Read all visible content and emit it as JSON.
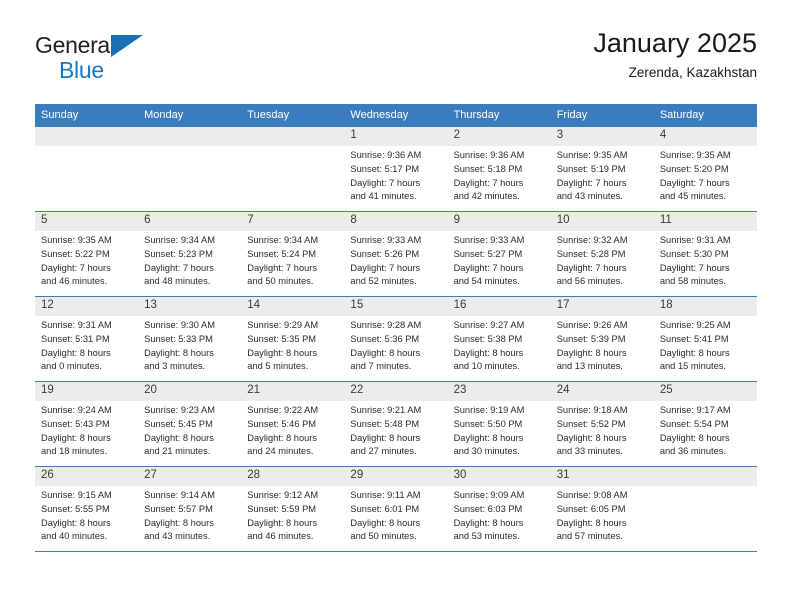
{
  "brand": {
    "name_part1": "General",
    "name_part2": "Blue",
    "flag_icon": "triangle-flag-icon"
  },
  "header": {
    "title": "January 2025",
    "subtitle": "Zerenda, Kazakhstan"
  },
  "colors": {
    "header_blue": "#3b7cbf",
    "brand_blue": "#1878c8",
    "daynum_band": "#ececec",
    "text": "#2b2b2b"
  },
  "weekday_headers": [
    "Sunday",
    "Monday",
    "Tuesday",
    "Wednesday",
    "Thursday",
    "Friday",
    "Saturday"
  ],
  "weeks": [
    [
      {
        "day": "",
        "empty": true,
        "sunrise": "",
        "sunset": "",
        "daylight_line1": "",
        "daylight_line2": ""
      },
      {
        "day": "",
        "empty": true,
        "sunrise": "",
        "sunset": "",
        "daylight_line1": "",
        "daylight_line2": ""
      },
      {
        "day": "",
        "empty": true,
        "sunrise": "",
        "sunset": "",
        "daylight_line1": "",
        "daylight_line2": ""
      },
      {
        "day": "1",
        "empty": false,
        "sunrise": "Sunrise: 9:36 AM",
        "sunset": "Sunset: 5:17 PM",
        "daylight_line1": "Daylight: 7 hours",
        "daylight_line2": "and 41 minutes."
      },
      {
        "day": "2",
        "empty": false,
        "sunrise": "Sunrise: 9:36 AM",
        "sunset": "Sunset: 5:18 PM",
        "daylight_line1": "Daylight: 7 hours",
        "daylight_line2": "and 42 minutes."
      },
      {
        "day": "3",
        "empty": false,
        "sunrise": "Sunrise: 9:35 AM",
        "sunset": "Sunset: 5:19 PM",
        "daylight_line1": "Daylight: 7 hours",
        "daylight_line2": "and 43 minutes."
      },
      {
        "day": "4",
        "empty": false,
        "sunrise": "Sunrise: 9:35 AM",
        "sunset": "Sunset: 5:20 PM",
        "daylight_line1": "Daylight: 7 hours",
        "daylight_line2": "and 45 minutes."
      }
    ],
    [
      {
        "day": "5",
        "empty": false,
        "sunrise": "Sunrise: 9:35 AM",
        "sunset": "Sunset: 5:22 PM",
        "daylight_line1": "Daylight: 7 hours",
        "daylight_line2": "and 46 minutes."
      },
      {
        "day": "6",
        "empty": false,
        "sunrise": "Sunrise: 9:34 AM",
        "sunset": "Sunset: 5:23 PM",
        "daylight_line1": "Daylight: 7 hours",
        "daylight_line2": "and 48 minutes."
      },
      {
        "day": "7",
        "empty": false,
        "sunrise": "Sunrise: 9:34 AM",
        "sunset": "Sunset: 5:24 PM",
        "daylight_line1": "Daylight: 7 hours",
        "daylight_line2": "and 50 minutes."
      },
      {
        "day": "8",
        "empty": false,
        "sunrise": "Sunrise: 9:33 AM",
        "sunset": "Sunset: 5:26 PM",
        "daylight_line1": "Daylight: 7 hours",
        "daylight_line2": "and 52 minutes."
      },
      {
        "day": "9",
        "empty": false,
        "sunrise": "Sunrise: 9:33 AM",
        "sunset": "Sunset: 5:27 PM",
        "daylight_line1": "Daylight: 7 hours",
        "daylight_line2": "and 54 minutes."
      },
      {
        "day": "10",
        "empty": false,
        "sunrise": "Sunrise: 9:32 AM",
        "sunset": "Sunset: 5:28 PM",
        "daylight_line1": "Daylight: 7 hours",
        "daylight_line2": "and 56 minutes."
      },
      {
        "day": "11",
        "empty": false,
        "sunrise": "Sunrise: 9:31 AM",
        "sunset": "Sunset: 5:30 PM",
        "daylight_line1": "Daylight: 7 hours",
        "daylight_line2": "and 58 minutes."
      }
    ],
    [
      {
        "day": "12",
        "empty": false,
        "sunrise": "Sunrise: 9:31 AM",
        "sunset": "Sunset: 5:31 PM",
        "daylight_line1": "Daylight: 8 hours",
        "daylight_line2": "and 0 minutes."
      },
      {
        "day": "13",
        "empty": false,
        "sunrise": "Sunrise: 9:30 AM",
        "sunset": "Sunset: 5:33 PM",
        "daylight_line1": "Daylight: 8 hours",
        "daylight_line2": "and 3 minutes."
      },
      {
        "day": "14",
        "empty": false,
        "sunrise": "Sunrise: 9:29 AM",
        "sunset": "Sunset: 5:35 PM",
        "daylight_line1": "Daylight: 8 hours",
        "daylight_line2": "and 5 minutes."
      },
      {
        "day": "15",
        "empty": false,
        "sunrise": "Sunrise: 9:28 AM",
        "sunset": "Sunset: 5:36 PM",
        "daylight_line1": "Daylight: 8 hours",
        "daylight_line2": "and 7 minutes."
      },
      {
        "day": "16",
        "empty": false,
        "sunrise": "Sunrise: 9:27 AM",
        "sunset": "Sunset: 5:38 PM",
        "daylight_line1": "Daylight: 8 hours",
        "daylight_line2": "and 10 minutes."
      },
      {
        "day": "17",
        "empty": false,
        "sunrise": "Sunrise: 9:26 AM",
        "sunset": "Sunset: 5:39 PM",
        "daylight_line1": "Daylight: 8 hours",
        "daylight_line2": "and 13 minutes."
      },
      {
        "day": "18",
        "empty": false,
        "sunrise": "Sunrise: 9:25 AM",
        "sunset": "Sunset: 5:41 PM",
        "daylight_line1": "Daylight: 8 hours",
        "daylight_line2": "and 15 minutes."
      }
    ],
    [
      {
        "day": "19",
        "empty": false,
        "sunrise": "Sunrise: 9:24 AM",
        "sunset": "Sunset: 5:43 PM",
        "daylight_line1": "Daylight: 8 hours",
        "daylight_line2": "and 18 minutes."
      },
      {
        "day": "20",
        "empty": false,
        "sunrise": "Sunrise: 9:23 AM",
        "sunset": "Sunset: 5:45 PM",
        "daylight_line1": "Daylight: 8 hours",
        "daylight_line2": "and 21 minutes."
      },
      {
        "day": "21",
        "empty": false,
        "sunrise": "Sunrise: 9:22 AM",
        "sunset": "Sunset: 5:46 PM",
        "daylight_line1": "Daylight: 8 hours",
        "daylight_line2": "and 24 minutes."
      },
      {
        "day": "22",
        "empty": false,
        "sunrise": "Sunrise: 9:21 AM",
        "sunset": "Sunset: 5:48 PM",
        "daylight_line1": "Daylight: 8 hours",
        "daylight_line2": "and 27 minutes."
      },
      {
        "day": "23",
        "empty": false,
        "sunrise": "Sunrise: 9:19 AM",
        "sunset": "Sunset: 5:50 PM",
        "daylight_line1": "Daylight: 8 hours",
        "daylight_line2": "and 30 minutes."
      },
      {
        "day": "24",
        "empty": false,
        "sunrise": "Sunrise: 9:18 AM",
        "sunset": "Sunset: 5:52 PM",
        "daylight_line1": "Daylight: 8 hours",
        "daylight_line2": "and 33 minutes."
      },
      {
        "day": "25",
        "empty": false,
        "sunrise": "Sunrise: 9:17 AM",
        "sunset": "Sunset: 5:54 PM",
        "daylight_line1": "Daylight: 8 hours",
        "daylight_line2": "and 36 minutes."
      }
    ],
    [
      {
        "day": "26",
        "empty": false,
        "sunrise": "Sunrise: 9:15 AM",
        "sunset": "Sunset: 5:55 PM",
        "daylight_line1": "Daylight: 8 hours",
        "daylight_line2": "and 40 minutes."
      },
      {
        "day": "27",
        "empty": false,
        "sunrise": "Sunrise: 9:14 AM",
        "sunset": "Sunset: 5:57 PM",
        "daylight_line1": "Daylight: 8 hours",
        "daylight_line2": "and 43 minutes."
      },
      {
        "day": "28",
        "empty": false,
        "sunrise": "Sunrise: 9:12 AM",
        "sunset": "Sunset: 5:59 PM",
        "daylight_line1": "Daylight: 8 hours",
        "daylight_line2": "and 46 minutes."
      },
      {
        "day": "29",
        "empty": false,
        "sunrise": "Sunrise: 9:11 AM",
        "sunset": "Sunset: 6:01 PM",
        "daylight_line1": "Daylight: 8 hours",
        "daylight_line2": "and 50 minutes."
      },
      {
        "day": "30",
        "empty": false,
        "sunrise": "Sunrise: 9:09 AM",
        "sunset": "Sunset: 6:03 PM",
        "daylight_line1": "Daylight: 8 hours",
        "daylight_line2": "and 53 minutes."
      },
      {
        "day": "31",
        "empty": false,
        "sunrise": "Sunrise: 9:08 AM",
        "sunset": "Sunset: 6:05 PM",
        "daylight_line1": "Daylight: 8 hours",
        "daylight_line2": "and 57 minutes."
      },
      {
        "day": "",
        "empty": true,
        "sunrise": "",
        "sunset": "",
        "daylight_line1": "",
        "daylight_line2": ""
      }
    ]
  ]
}
